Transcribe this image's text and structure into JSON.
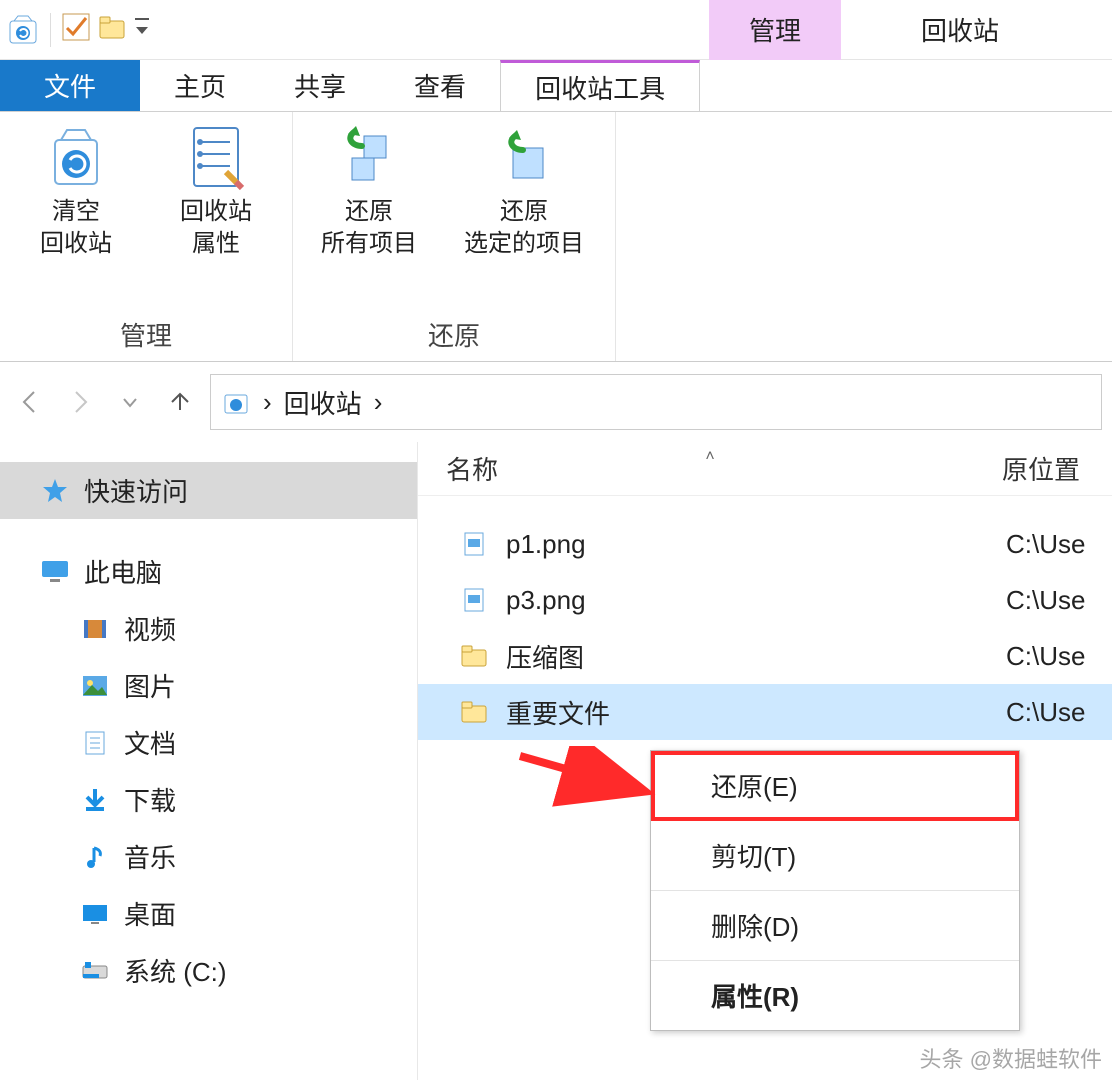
{
  "titlebar": {
    "context_tab": "管理",
    "window_title": "回收站"
  },
  "tabs": {
    "file": "文件",
    "home": "主页",
    "share": "共享",
    "view": "查看",
    "recycle_tools": "回收站工具"
  },
  "ribbon": {
    "group_manage": "管理",
    "group_restore": "还原",
    "empty_bin": "清空\n回收站",
    "bin_props": "回收站\n属性",
    "restore_all": "还原\n所有项目",
    "restore_selected": "还原\n选定的项目"
  },
  "address": {
    "location": "回收站",
    "sep": "›"
  },
  "columns": {
    "name": "名称",
    "orig_location": "原位置"
  },
  "sidebar": {
    "quick_access": "快速访问",
    "this_pc": "此电脑",
    "videos": "视频",
    "pictures": "图片",
    "documents": "文档",
    "downloads": "下载",
    "music": "音乐",
    "desktop": "桌面",
    "system_c": "系统 (C:)"
  },
  "files": [
    {
      "name": "p1.png",
      "loc": "C:\\Use",
      "type": "img"
    },
    {
      "name": "p3.png",
      "loc": "C:\\Use",
      "type": "img"
    },
    {
      "name": "压缩图",
      "loc": "C:\\Use",
      "type": "folder"
    },
    {
      "name": "重要文件",
      "loc": "C:\\Use",
      "type": "folder",
      "selected": true
    }
  ],
  "context_menu": {
    "restore": "还原(E)",
    "cut": "剪切(T)",
    "delete": "删除(D)",
    "properties": "属性(R)"
  },
  "watermark": "头条 @数据蛙软件"
}
